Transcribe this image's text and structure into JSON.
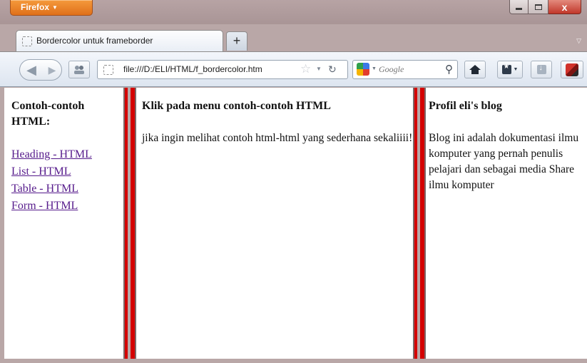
{
  "browser": {
    "app_button_label": "Firefox",
    "tab_title": "Bordercolor untuk frameborder",
    "new_tab_label": "+",
    "url": "file:///D:/ELI/HTML/f_bordercolor.htm",
    "search_placeholder": "Google",
    "close_label": "x"
  },
  "frames": {
    "left": {
      "heading": "Contoh-contoh HTML:",
      "links": [
        "Heading - HTML",
        "List - HTML",
        "Table - HTML",
        "Form - HTML"
      ]
    },
    "middle": {
      "heading": "Klik pada menu contoh-contoh HTML",
      "body": "jika ingin melihat contoh html-html yang sederhana sekaliiii!"
    },
    "right": {
      "heading": "Profil eli's blog",
      "body": "Blog ini adalah dokumentasi ilmu komputer yang pernah penulis pelajari dan sebagai media Share ilmu komputer"
    },
    "border_color": "#d40000"
  },
  "icons": {
    "back": "back-arrow-icon",
    "forward": "forward-arrow-icon",
    "reload": "reload-icon",
    "star": "bookmark-star-icon",
    "home": "home-icon"
  }
}
